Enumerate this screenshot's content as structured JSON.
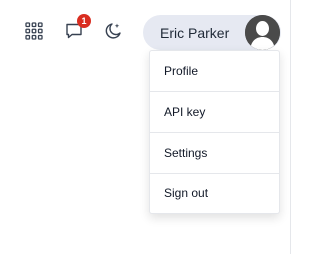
{
  "header": {
    "icons": {
      "apps": "grid-icon",
      "messages": "chat-bubble-icon",
      "theme": "moon-sparkle-icon"
    },
    "messages_badge": "1",
    "user": {
      "name": "Eric Parker",
      "avatar": "avatar-silhouette"
    }
  },
  "user_menu": {
    "items": [
      {
        "label": "Profile"
      },
      {
        "label": "API key"
      },
      {
        "label": "Settings"
      },
      {
        "label": "Sign out"
      }
    ]
  },
  "colors": {
    "pill_bg": "#e6e9f2",
    "badge": "#d92d20",
    "icon": "#374151"
  }
}
